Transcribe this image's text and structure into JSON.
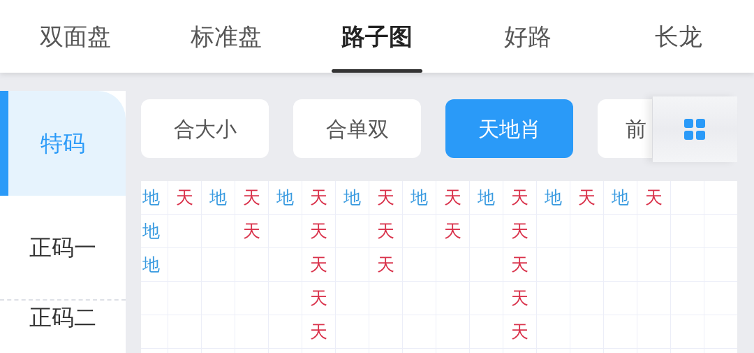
{
  "tabs": [
    {
      "label": "双面盘",
      "selected": false
    },
    {
      "label": "标准盘",
      "selected": false
    },
    {
      "label": "路子图",
      "selected": true
    },
    {
      "label": "好路",
      "selected": false
    },
    {
      "label": "长龙",
      "selected": false
    }
  ],
  "sidebar": {
    "items": [
      {
        "label": "特码",
        "selected": true
      },
      {
        "label": "正码一",
        "selected": false
      },
      {
        "label": "正码二",
        "selected": false
      }
    ]
  },
  "filters": [
    {
      "label": "合大小",
      "selected": false
    },
    {
      "label": "合单双",
      "selected": false
    },
    {
      "label": "天地肖",
      "selected": true
    },
    {
      "label": "前",
      "selected": false
    }
  ],
  "road": {
    "columns": [
      [
        {
          "text": "地",
          "color": "#3a9be0"
        },
        {
          "text": "地",
          "color": "#3a9be0"
        },
        {
          "text": "地",
          "color": "#3a9be0"
        }
      ],
      [
        {
          "text": "天",
          "color": "#d9314a"
        }
      ],
      [
        {
          "text": "地",
          "color": "#3a9be0"
        }
      ],
      [
        {
          "text": "天",
          "color": "#d9314a"
        },
        {
          "text": "天",
          "color": "#d9314a"
        }
      ],
      [
        {
          "text": "地",
          "color": "#3a9be0"
        }
      ],
      [
        {
          "text": "天",
          "color": "#d9314a"
        },
        {
          "text": "天",
          "color": "#d9314a"
        },
        {
          "text": "天",
          "color": "#d9314a"
        },
        {
          "text": "天",
          "color": "#d9314a"
        },
        {
          "text": "天",
          "color": "#d9314a"
        }
      ],
      [
        {
          "text": "地",
          "color": "#3a9be0"
        }
      ],
      [
        {
          "text": "天",
          "color": "#d9314a"
        },
        {
          "text": "天",
          "color": "#d9314a"
        },
        {
          "text": "天",
          "color": "#d9314a"
        }
      ],
      [
        {
          "text": "地",
          "color": "#3a9be0"
        }
      ],
      [
        {
          "text": "天",
          "color": "#d9314a"
        },
        {
          "text": "天",
          "color": "#d9314a"
        }
      ],
      [
        {
          "text": "地",
          "color": "#3a9be0"
        }
      ],
      [
        {
          "text": "天",
          "color": "#d9314a"
        },
        {
          "text": "天",
          "color": "#d9314a"
        },
        {
          "text": "天",
          "color": "#d9314a"
        },
        {
          "text": "天",
          "color": "#d9314a"
        },
        {
          "text": "天",
          "color": "#d9314a"
        }
      ],
      [
        {
          "text": "地",
          "color": "#3a9be0"
        }
      ],
      [
        {
          "text": "天",
          "color": "#d9314a"
        }
      ],
      [
        {
          "text": "地",
          "color": "#3a9be0"
        }
      ],
      [
        {
          "text": "天",
          "color": "#d9314a"
        }
      ],
      [],
      []
    ]
  }
}
